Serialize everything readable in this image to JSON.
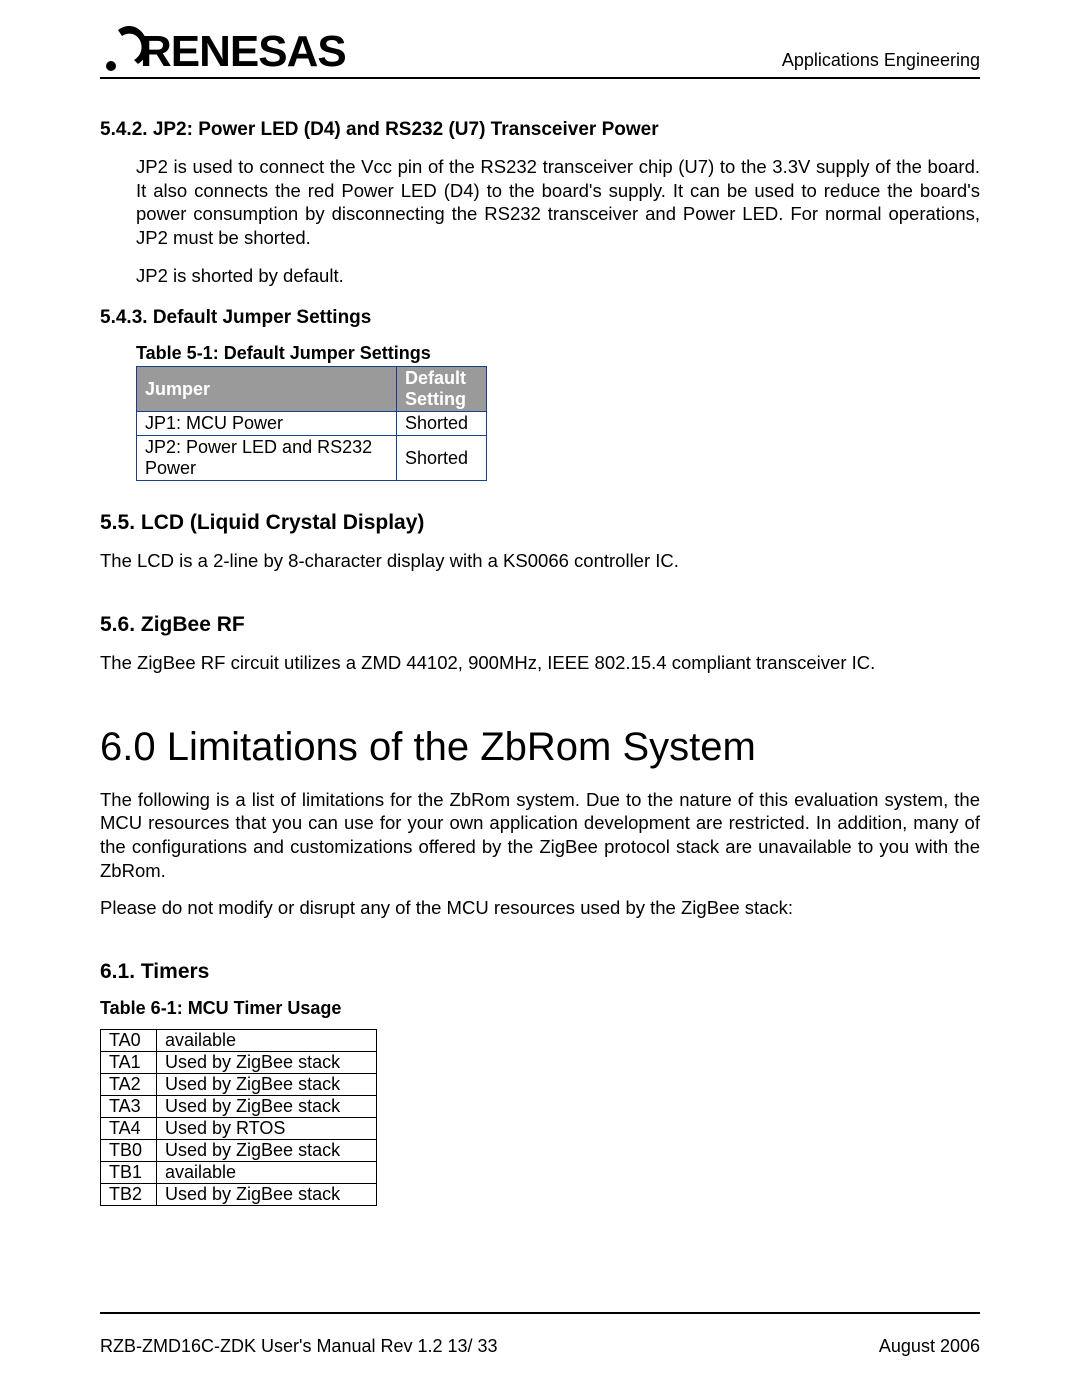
{
  "header": {
    "right_text": "Applications Engineering",
    "logo_text": "RENESAS"
  },
  "s542": {
    "heading": "5.4.2. JP2: Power LED (D4) and RS232 (U7) Transceiver Power",
    "p1": "JP2 is used to connect the Vcc pin of the RS232 transceiver chip (U7) to the 3.3V supply of the board. It also connects the red Power LED (D4) to the board's supply. It can be used to reduce the board's power consumption by disconnecting the RS232 transceiver and Power LED. For normal operations, JP2 must be shorted.",
    "p2": "JP2 is shorted by default."
  },
  "s543": {
    "heading": "5.4.3. Default Jumper Settings",
    "table_caption": "Table 5-1: Default Jumper Settings",
    "col0": "Jumper",
    "col1": "Default Setting",
    "rows": [
      {
        "jumper": "JP1: MCU Power",
        "setting": "Shorted"
      },
      {
        "jumper": "JP2: Power LED and RS232 Power",
        "setting": "Shorted"
      }
    ]
  },
  "s55": {
    "heading": "5.5. LCD (Liquid Crystal Display)",
    "p1": "The LCD is a 2-line by 8-character display with a KS0066 controller IC."
  },
  "s56": {
    "heading": "5.6. ZigBee RF",
    "p1": "The ZigBee RF circuit utilizes a ZMD 44102, 900MHz, IEEE 802.15.4 compliant transceiver IC."
  },
  "s60": {
    "heading": "6.0 Limitations of the ZbRom System",
    "p1": "The following is a list of limitations for the ZbRom system. Due to the nature of this evaluation system, the MCU resources that you can use for your own application development are restricted. In addition, many of the configurations and customizations offered by the ZigBee protocol stack are unavailable to you with the ZbRom.",
    "p2": "Please do not modify or disrupt any of the MCU resources used by the ZigBee stack:"
  },
  "s61": {
    "heading": "6.1. Timers",
    "table_caption": "Table 6-1: MCU Timer Usage",
    "rows": [
      {
        "name": "TA0",
        "use": "available"
      },
      {
        "name": "TA1",
        "use": "Used by ZigBee stack"
      },
      {
        "name": "TA2",
        "use": "Used by ZigBee stack"
      },
      {
        "name": "TA3",
        "use": "Used by ZigBee stack"
      },
      {
        "name": "TA4",
        "use": "Used by RTOS"
      },
      {
        "name": "TB0",
        "use": "Used by ZigBee stack"
      },
      {
        "name": "TB1",
        "use": "available"
      },
      {
        "name": "TB2",
        "use": "Used by ZigBee stack"
      }
    ]
  },
  "footer": {
    "left": "RZB-ZMD16C-ZDK User's Manual Rev 1.2    13/ 33",
    "right": "August 2006"
  }
}
